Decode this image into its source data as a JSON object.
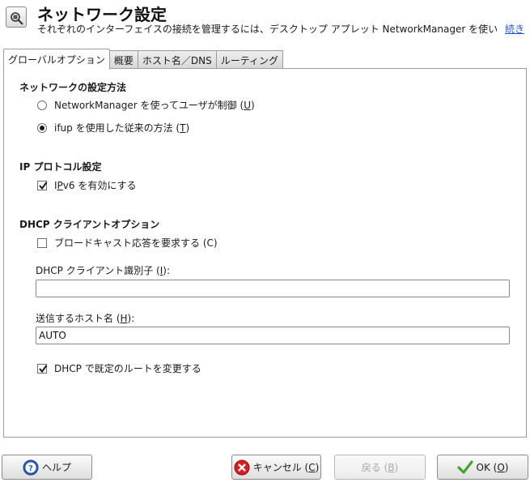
{
  "header": {
    "title": "ネットワーク設定",
    "description": "それぞれのインターフェイスの接続を管理するには、デスクトップ アプレット NetworkManager を使います...",
    "more_link": "続き"
  },
  "tabs": [
    {
      "label": "グローバルオプション",
      "active": true
    },
    {
      "label": "概要",
      "active": false
    },
    {
      "label": "ホスト名／DNS",
      "active": false
    },
    {
      "label": "ルーティング",
      "active": false
    }
  ],
  "setup_method": {
    "title": "ネットワークの設定方法",
    "options": [
      {
        "pre": "NetworkManager を使ってユーザが制御 (",
        "key": "U",
        "post": ")",
        "selected": false
      },
      {
        "pre": "ifup を使用した従来の方法 (",
        "key": "T",
        "post": ")",
        "selected": true
      }
    ]
  },
  "ip_protocol": {
    "title": "IP プロトコル設定",
    "ipv6": {
      "pre": "I",
      "key": "P",
      "post": "v6 を有効にする",
      "checked": true
    }
  },
  "dhcp": {
    "title": "DHCP クライアントオプション",
    "broadcast": {
      "label": "ブロードキャスト応答を要求する (C)",
      "checked": false
    },
    "client_id": {
      "pre": "DHCP クライアント識別子 (",
      "key": "I",
      "post": "):",
      "value": ""
    },
    "hostname": {
      "pre": "送信するホスト名 (",
      "key": "H",
      "post": "):",
      "value": "AUTO"
    },
    "default_route": {
      "label": "DHCP で既定のルートを変更する",
      "checked": true
    }
  },
  "buttons": {
    "help": "ヘルプ",
    "cancel": {
      "pre": "キャンセル (",
      "key": "C",
      "post": ")"
    },
    "back": {
      "pre": "戻る (",
      "key": "B",
      "post": ")"
    },
    "ok": {
      "pre": "OK (",
      "key": "O",
      "post": ")"
    }
  },
  "colors": {
    "link": "#2a55c9",
    "ok_check": "#3fa62b",
    "cancel_red": "#d42020",
    "help_blue": "#2d5fb8"
  }
}
